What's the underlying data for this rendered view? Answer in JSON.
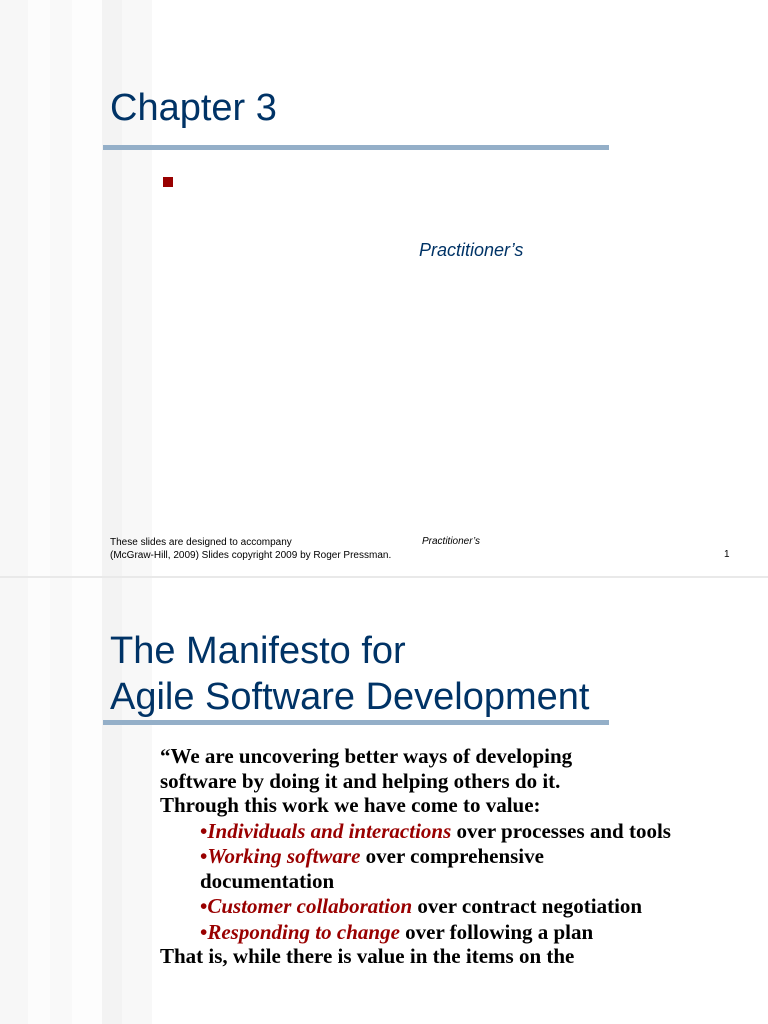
{
  "slide1": {
    "title": "Chapter 3",
    "subtitle_italic": "Practitioner’s",
    "footer_line1": "These slides are designed to accompany",
    "footer_line2": "(McGraw-Hill, 2009) Slides copyright 2009 by Roger Pressman.",
    "footer_italic": "Practitioner’s",
    "page_number": "1"
  },
  "slide2": {
    "title_line1": "The Manifesto for",
    "title_line2": "Agile Software Development",
    "intro": "“We are uncovering better ways of developing\nsoftware by doing it and helping others do it.\nThrough this work we have come to value:",
    "values": [
      {
        "bullet": "•",
        "term": "Individuals and interactions",
        "rest": " over processes and tools"
      },
      {
        "bullet": "•",
        "term": "Working software",
        "rest": " over comprehensive documentation"
      },
      {
        "bullet": "•",
        "term": "Customer collaboration",
        "rest": " over contract negotiation"
      },
      {
        "bullet": "•",
        "term": "Responding to change",
        "rest": " over following a plan"
      }
    ],
    "closing": "That is, while there is value in the items on the"
  },
  "colors": {
    "title": "#003366",
    "accent_red": "#990000",
    "rule": "#94afc8"
  }
}
